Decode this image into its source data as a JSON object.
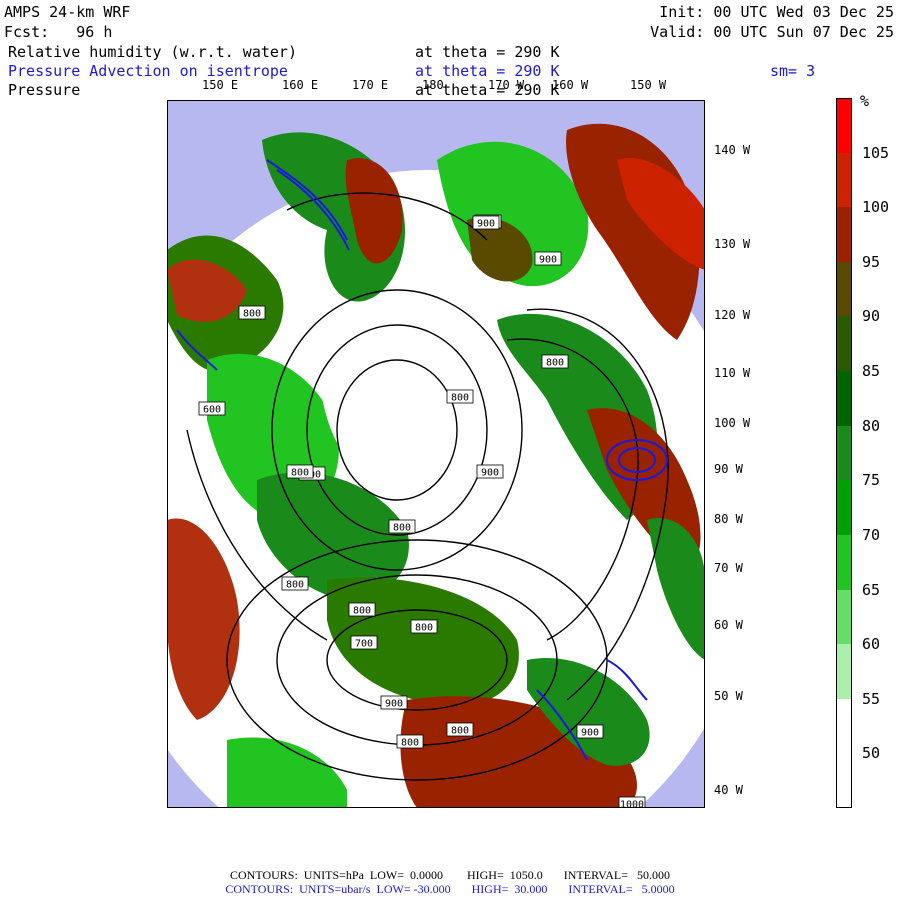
{
  "header": {
    "model": "AMPS 24-km WRF",
    "fcst_label": "Fcst:",
    "fcst_value": "96 h",
    "init": "Init: 00 UTC Wed 03 Dec 25",
    "valid": "Valid: 00 UTC Sun 07 Dec 25"
  },
  "fields": [
    {
      "label": "Relative humidity (w.r.t. water)",
      "level": "at theta = 290 K",
      "color": "#000000"
    },
    {
      "label": "Pressure Advection on isentrope",
      "level": "at theta = 290 K",
      "color": "#1a1adc"
    },
    {
      "label": "Pressure",
      "level": "at theta = 290 K",
      "color": "#000000"
    }
  ],
  "smoothing": "sm= 3",
  "lon_top": [
    "150 E",
    "160 E",
    "170 E",
    "180",
    "170 W",
    "160 W",
    "150 W"
  ],
  "lon_right": [
    "140 W",
    "130 W",
    "120 W",
    "110 W",
    "100 W",
    "90 W",
    "80 W",
    "70 W",
    "60 W",
    "50 W",
    "40 W"
  ],
  "pressure_labels": [
    "900",
    "900",
    "900",
    "800",
    "800",
    "800",
    "800",
    "800",
    "700",
    "800",
    "900",
    "600",
    "800",
    "800",
    "900",
    "800",
    "900",
    "1000",
    "800",
    "800"
  ],
  "colorbar": {
    "unit": "%",
    "labels": [
      "105",
      "100",
      "95",
      "90",
      "85",
      "80",
      "75",
      "70",
      "65",
      "60",
      "55",
      "50"
    ],
    "colors": [
      "#ff0000",
      "#cc2200",
      "#992200",
      "#5a4a00",
      "#2b5a00",
      "#006400",
      "#1a8a1a",
      "#00a000",
      "#22c422",
      "#66dd66",
      "#aaf0aa",
      "#ffffff",
      "#ffffff"
    ]
  },
  "footer": {
    "line1": "CONTOURS:  UNITS=hPa  LOW=  0.0000        HIGH=  1050.0       INTERVAL=   50.000",
    "line2": "CONTOURS:  UNITS=ubar/s  LOW= -30.000       HIGH=  30.000       INTERVAL=   5.0000"
  }
}
